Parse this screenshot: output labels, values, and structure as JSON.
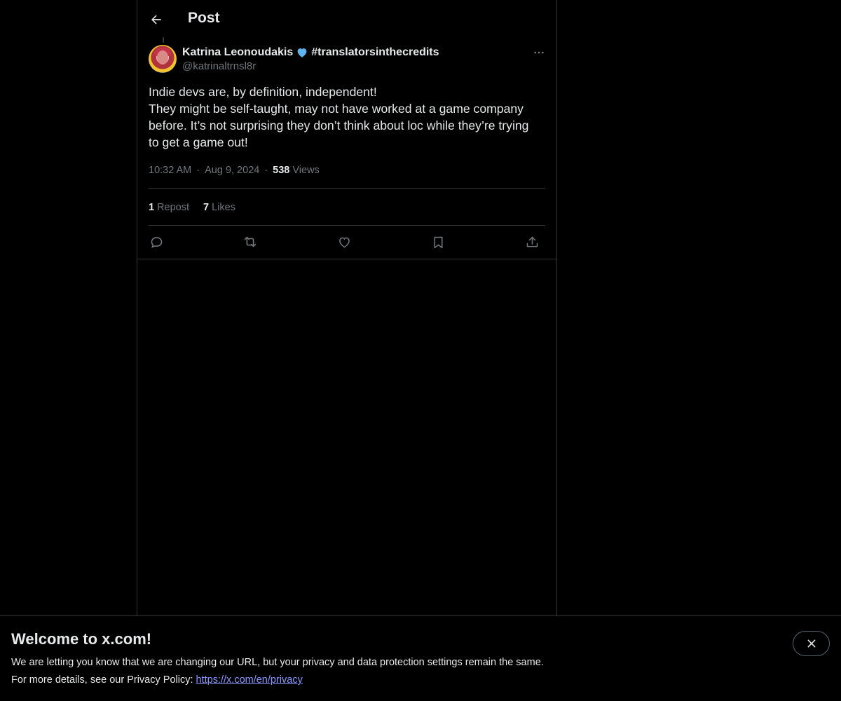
{
  "header": {
    "title": "Post"
  },
  "post": {
    "author": {
      "display_name": "Katrina Leonoudakis",
      "hashtag": "#translatorsinthecredits",
      "handle": "@katrinaltrnsl8r"
    },
    "text_lines": [
      "Indie devs are, by definition, independent!",
      "They might be self-taught, may not have worked at a game company",
      "before. It’s not surprising they don’t think about loc while they’re trying",
      "to get a game out!"
    ],
    "time": "10:32 AM",
    "separator": "·",
    "date": "Aug 9, 2024",
    "views_count": "538",
    "views_label": "Views",
    "reposts_count": "1",
    "reposts_label": "Repost",
    "likes_count": "7",
    "likes_label": "Likes"
  },
  "banner": {
    "title": "Welcome to x.com!",
    "line1": "We are letting you know that we are changing our URL, but your privacy and data protection settings remain the same.",
    "line2_prefix": "For more details, see our Privacy Policy: ",
    "link_text": "https://x.com/en/privacy"
  },
  "colors": {
    "background": "#000000",
    "text_primary": "#e7e9ea",
    "text_secondary": "#71767b",
    "border": "#2f3336",
    "link": "#8b98ff",
    "heart_emoji": "#5eb3f0"
  },
  "icons": {
    "back": "arrow-left-icon",
    "more": "more-horizontal-icon",
    "reply": "reply-icon",
    "repost": "repost-icon",
    "like": "heart-icon",
    "bookmark": "bookmark-icon",
    "share": "share-icon",
    "close": "close-icon"
  }
}
